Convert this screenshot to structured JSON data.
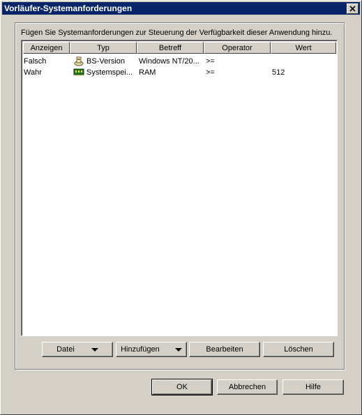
{
  "window": {
    "title": "Vorläufer-Systemanforderungen"
  },
  "instruction": "Fügen Sie Systemanforderungen zur Steuerung der Verfügbarkeit dieser Anwendung hinzu.",
  "columns": [
    "Anzeigen",
    "Typ",
    "Betreff",
    "Operator",
    "Wert"
  ],
  "rows": [
    {
      "anzeigen": "Falsch",
      "typ": "BS-Version",
      "typ_icon": "os-version-icon",
      "betreff": "Windows NT/20...",
      "operator": ">=",
      "wert": ""
    },
    {
      "anzeigen": "Wahr",
      "typ": "Systemspei...",
      "typ_icon": "memory-icon",
      "betreff": "RAM",
      "operator": ">=",
      "wert": "512"
    }
  ],
  "list_buttons": {
    "datei": "Datei",
    "hinzufuegen": "Hinzufügen",
    "bearbeiten": "Bearbeiten",
    "loeschen": "Löschen"
  },
  "dialog_buttons": {
    "ok": "OK",
    "abbrechen": "Abbrechen",
    "hilfe": "Hilfe"
  }
}
